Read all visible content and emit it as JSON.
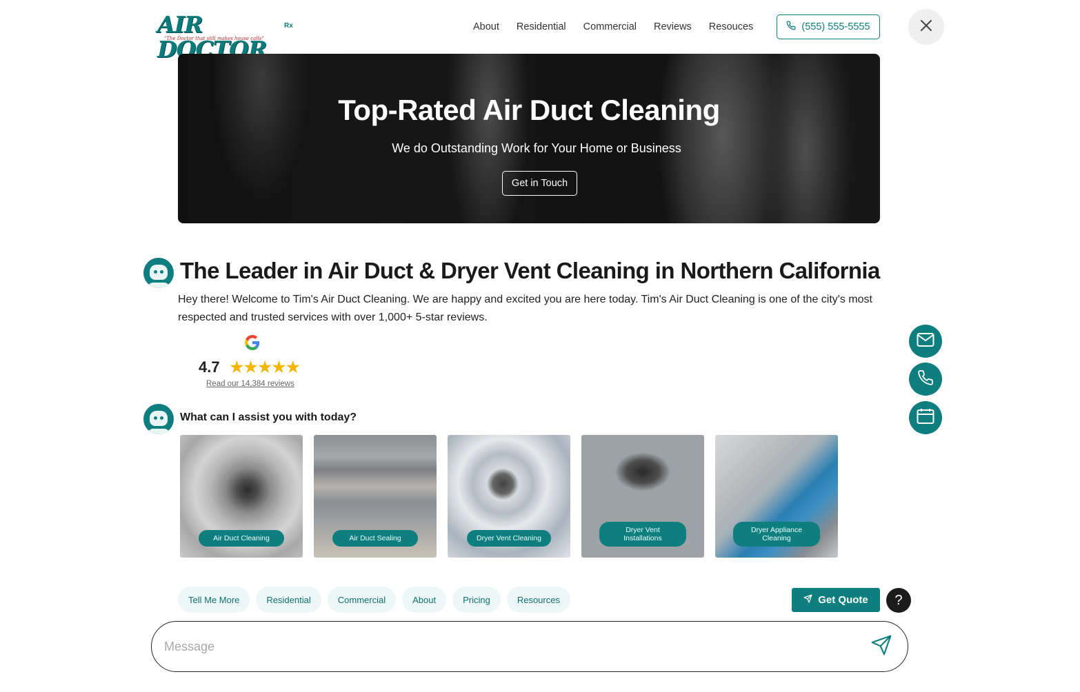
{
  "brand": {
    "name": "AIR DOCTOR",
    "tagline": "\"The Doctor that still makes house calls\"",
    "mark": "Rx"
  },
  "nav": {
    "items": [
      {
        "label": "About"
      },
      {
        "label": "Residential"
      },
      {
        "label": "Commercial"
      },
      {
        "label": "Reviews"
      },
      {
        "label": "Resouces"
      }
    ],
    "phone": "(555) 555-5555"
  },
  "hero": {
    "title": "Top-Rated Air Duct Cleaning",
    "subtitle": "We do Outstanding Work for Your Home or Business",
    "cta": "Get in Touch"
  },
  "chat": {
    "headline": "The Leader in Air Duct & Dryer Vent Cleaning in Northern California",
    "intro": "Hey there! Welcome to Tim's Air Duct Cleaning. We are happy and excited you are here today. Tim's Air Duct Cleaning is one of the city's most respected and trusted services with over 1,000+ 5-star reviews.",
    "rating": {
      "value": "4.7",
      "stars": "★★★★★",
      "reviews_link": "Read our 14,384 reviews"
    },
    "prompt": "What can I assist you with today?",
    "services": [
      {
        "label": "Air Duct Cleaning"
      },
      {
        "label": "Air Duct Sealing"
      },
      {
        "label": "Dryer Vent Cleaning"
      },
      {
        "label": "Dryer Vent Installations"
      },
      {
        "label": "Dryer Appliance Cleaning"
      }
    ],
    "quick_replies": [
      {
        "label": "Tell Me More"
      },
      {
        "label": "Residential"
      },
      {
        "label": "Commercial"
      },
      {
        "label": "About"
      },
      {
        "label": "Pricing"
      },
      {
        "label": "Resources"
      }
    ],
    "quote_button": "Get Quote",
    "help_button": "?",
    "message_placeholder": "Message"
  },
  "colors": {
    "accent": "#0f7e7e",
    "star": "#f5b400",
    "chip_bg": "#eef7f7"
  },
  "icons": {
    "close": "close-icon",
    "phone": "phone-icon",
    "send": "send-icon",
    "mail": "mail-icon",
    "calendar": "calendar-icon",
    "google": "google-icon"
  }
}
